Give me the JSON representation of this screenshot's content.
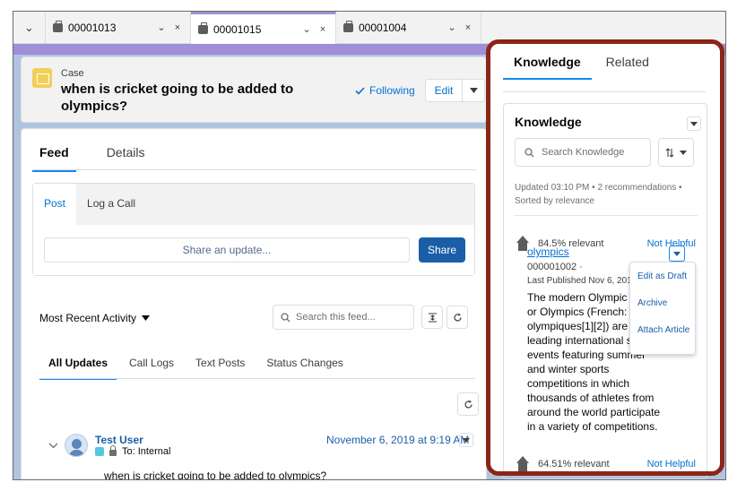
{
  "tabs": {
    "items": [
      {
        "label": "00001013"
      },
      {
        "label": "00001015"
      },
      {
        "label": "00001004"
      }
    ],
    "overflow_glyph": "⌄",
    "chevron_glyph": "⌄",
    "close_glyph": "×"
  },
  "case": {
    "object_type": "Case",
    "title": "when is cricket going to be added to olympics?",
    "following_label": "Following",
    "edit_label": "Edit"
  },
  "main": {
    "tabs": [
      {
        "label": "Feed"
      },
      {
        "label": "Details"
      }
    ],
    "publisher": {
      "tabs": [
        {
          "label": "Post"
        },
        {
          "label": "Log a Call"
        }
      ],
      "placeholder": "Share an update...",
      "share_label": "Share"
    },
    "sort_label": "Most Recent Activity",
    "search_placeholder": "Search this feed...",
    "filters": [
      {
        "label": "All Updates"
      },
      {
        "label": "Call Logs"
      },
      {
        "label": "Text Posts"
      },
      {
        "label": "Status Changes"
      }
    ],
    "post": {
      "user": "Test User",
      "visibility": "To: Internal",
      "date": "November 6, 2019 at 9:19 AM",
      "body": "when is cricket going to be added to olympics?"
    }
  },
  "knowledge": {
    "tabs": [
      {
        "label": "Knowledge"
      },
      {
        "label": "Related"
      }
    ],
    "title": "Knowledge",
    "search_placeholder": "Search Knowledge",
    "status_line1": "Updated 03:10 PM • 2 recommendations •",
    "status_line2": "Sorted by relevance",
    "articles": [
      {
        "relevance": "84.5% relevant",
        "not_helpful": "Not Helpful",
        "title": "olympics",
        "number": "000001002 ·",
        "published": "Last Published  Nov 6, 2019",
        "description": "The modern Olympic Games or Olympics (French: Jeux olympiques[1][2]) are leading international sporting events featuring summer and winter sports competitions in which thousands of athletes from around the world participate in a variety of competitions."
      },
      {
        "relevance": "64.51% relevant",
        "not_helpful": "Not Helpful"
      }
    ],
    "menu": [
      {
        "label": "Edit as Draft"
      },
      {
        "label": "Archive"
      },
      {
        "label": "Attach Article"
      }
    ]
  },
  "colors": {
    "accent": "#a08ed6",
    "brand_blue": "#1a5ea8",
    "link": "#0070d2",
    "highlight": "#8b2518",
    "case_icon": "#f2cf5b"
  }
}
